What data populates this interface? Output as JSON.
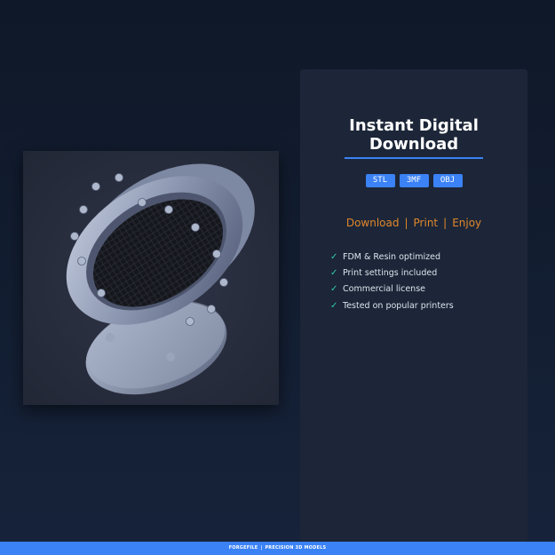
{
  "product": {
    "image_alt": "3D printable flanged porthole model"
  },
  "card": {
    "title_line1": "Instant Digital",
    "title_line2": "Download",
    "formats": [
      "STL",
      "3MF",
      "OBJ"
    ],
    "taglines": [
      "Download",
      "Print",
      "Enjoy"
    ],
    "features": [
      "FDM & Resin optimized",
      "Print settings included",
      "Commercial license",
      "Tested on popular printers"
    ]
  },
  "footer": {
    "brand": "FORGEFILE",
    "tagline": "PRECISION 3D MODELS"
  },
  "colors": {
    "accent": "#3b82f6",
    "tagline": "#e0872c",
    "check": "#31c9a8",
    "background": "#131d2f",
    "card": "#1c2638"
  },
  "icons": {
    "check": "check-icon"
  }
}
